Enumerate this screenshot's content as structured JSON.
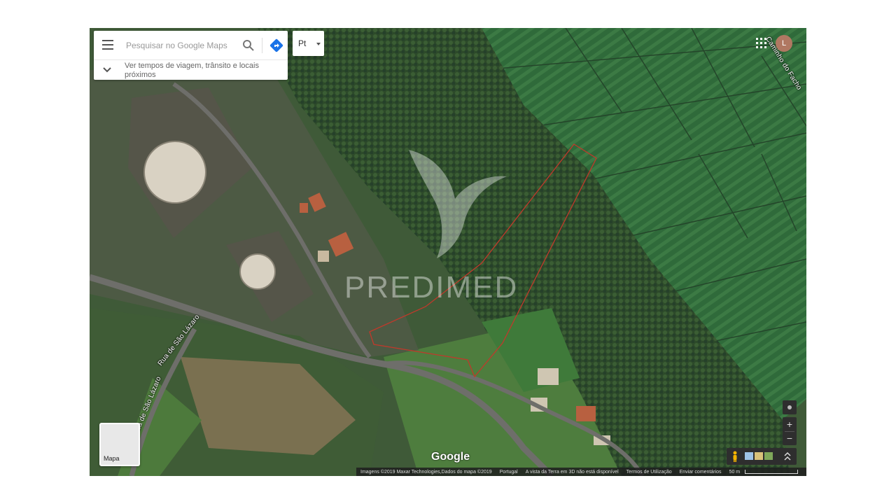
{
  "search": {
    "placeholder": "Pesquisar no Google Maps"
  },
  "travel": {
    "text": "Ver tempos de viagem, trânsito e locais próximos"
  },
  "language": {
    "selected": "Pt"
  },
  "account": {
    "avatar_letter": "L"
  },
  "watermark": {
    "text": "PREDIMED"
  },
  "map": {
    "roads": [
      "Rua de São Lázaro",
      "Rua de São Lázaro",
      "Caminho do Facho"
    ],
    "google_logo": "Google",
    "layer_label": "Mapa"
  },
  "attribution": {
    "imagery": "Imagens ©2019 Maxar Technologies,Dados do mapa ©2019",
    "country": "Portugal",
    "notice_3d": "A vista da Terra em 3D não está disponível",
    "terms": "Termos de Utilização",
    "feedback": "Enviar comentários",
    "scale": "50 m"
  },
  "icons": [
    "menu-icon",
    "search-icon",
    "directions-icon",
    "chevron-down-icon",
    "apps-icon",
    "my-location-icon",
    "zoom-in-icon",
    "zoom-out-icon",
    "pegman-icon",
    "expand-icon"
  ],
  "colors": {
    "directions": "#1a73e8",
    "avatar": "#b07862",
    "boundary": "#c0392b"
  }
}
